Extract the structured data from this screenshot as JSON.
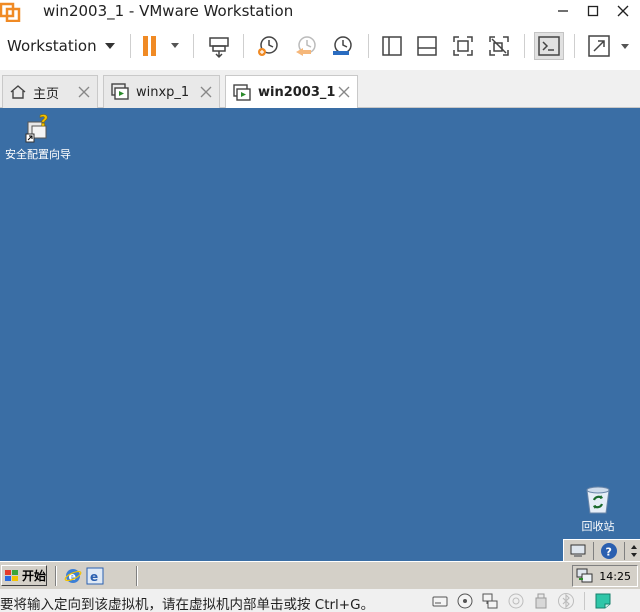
{
  "window": {
    "title": "win2003_1 - VMware Workstation"
  },
  "toolbar": {
    "workstation_label": "Workstation"
  },
  "tabs": [
    {
      "label": "主页",
      "icon": "home-icon",
      "active": false
    },
    {
      "label": "winxp_1",
      "icon": "vm-icon",
      "active": false
    },
    {
      "label": "win2003_1",
      "icon": "vm-icon",
      "active": true
    }
  ],
  "guest": {
    "desktop_color": "#3a6ea5",
    "desktop_icons": [
      {
        "label": "安全配置向导",
        "icon": "security-wizard-icon"
      },
      {
        "label": "回收站",
        "icon": "recycle-bin-icon"
      }
    ],
    "taskbar": {
      "start_label": "开始",
      "clock": "14:25",
      "quick_launch": [
        "ie-icon",
        "ie-alt-icon"
      ]
    }
  },
  "statusbar": {
    "text": "要将输入定向到该虚拟机，请在虚拟机内部单击或按 Ctrl+G。"
  },
  "colors": {
    "accent_orange": "#f08a24",
    "chrome_gray": "#f0f0f0",
    "guest_gray": "#d4d0c8"
  }
}
